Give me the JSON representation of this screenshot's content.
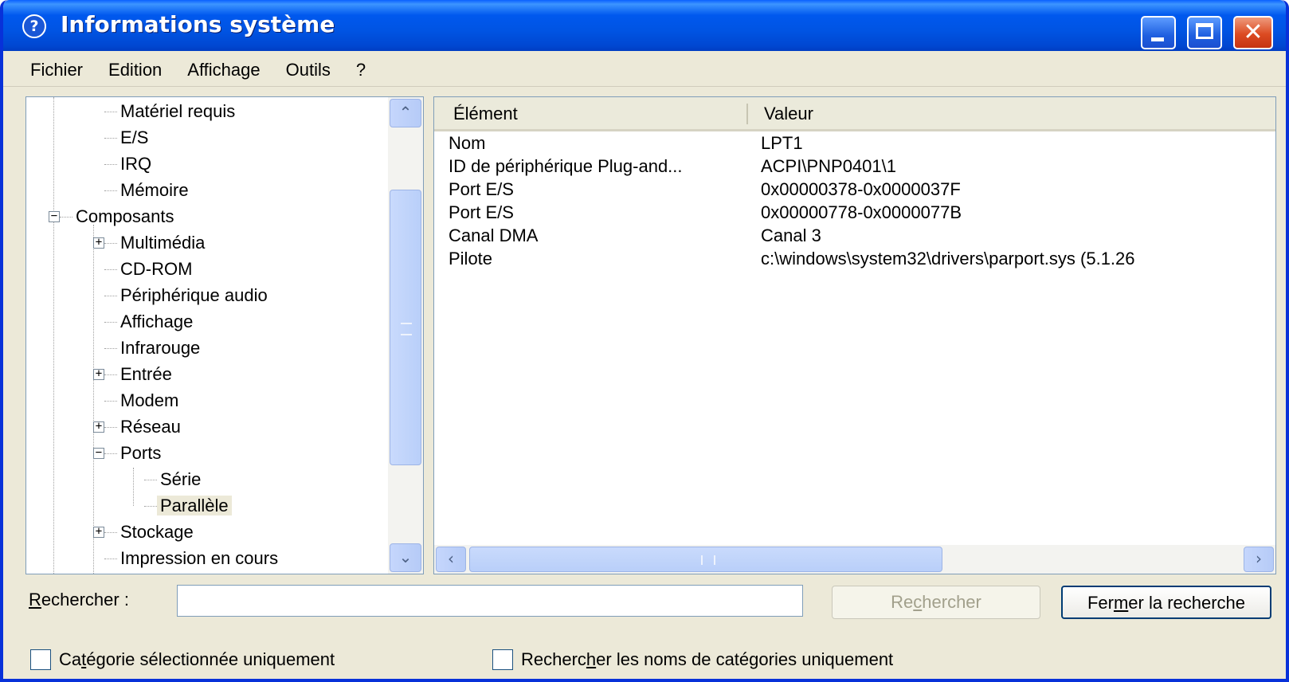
{
  "window": {
    "title": "Informations système",
    "title_icon": "help-circle-icon",
    "controls": [
      "minimize",
      "maximize",
      "close"
    ]
  },
  "menu": [
    "Fichier",
    "Edition",
    "Affichage",
    "Outils",
    "?"
  ],
  "tree": [
    {
      "label": "Matériel requis",
      "level": 2,
      "expander": null
    },
    {
      "label": "E/S",
      "level": 2,
      "expander": null
    },
    {
      "label": "IRQ",
      "level": 2,
      "expander": null
    },
    {
      "label": "Mémoire",
      "level": 2,
      "expander": null
    },
    {
      "label": "Composants",
      "level": 1,
      "expander": "minus"
    },
    {
      "label": "Multimédia",
      "level": 2,
      "expander": "plus"
    },
    {
      "label": "CD-ROM",
      "level": 2,
      "expander": null
    },
    {
      "label": "Périphérique audio",
      "level": 2,
      "expander": null
    },
    {
      "label": "Affichage",
      "level": 2,
      "expander": null
    },
    {
      "label": "Infrarouge",
      "level": 2,
      "expander": null
    },
    {
      "label": "Entrée",
      "level": 2,
      "expander": "plus"
    },
    {
      "label": "Modem",
      "level": 2,
      "expander": null
    },
    {
      "label": "Réseau",
      "level": 2,
      "expander": "plus"
    },
    {
      "label": "Ports",
      "level": 2,
      "expander": "minus"
    },
    {
      "label": "Série",
      "level": 3,
      "expander": null
    },
    {
      "label": "Parallèle",
      "level": 3,
      "expander": null,
      "selected": true
    },
    {
      "label": "Stockage",
      "level": 2,
      "expander": "plus"
    },
    {
      "label": "Impression en cours",
      "level": 2,
      "expander": null
    }
  ],
  "list": {
    "columns": [
      "Élément",
      "Valeur"
    ],
    "rows": [
      [
        "Nom",
        "LPT1"
      ],
      [
        "ID de périphérique Plug-and...",
        "ACPI\\PNP0401\\1"
      ],
      [
        "Port E/S",
        "0x00000378-0x0000037F"
      ],
      [
        "Port E/S",
        "0x00000778-0x0000077B"
      ],
      [
        "Canal DMA",
        "Canal 3"
      ],
      [
        "Pilote",
        "c:\\windows\\system32\\drivers\\parport.sys (5.1.26"
      ]
    ]
  },
  "search": {
    "label_first": "R",
    "label_rest": "echercher :",
    "value": "",
    "button_search_a": "Re",
    "button_search_u": "c",
    "button_search_b": "hercher",
    "button_close_a": "Fer",
    "button_close_u": "m",
    "button_close_b": "er la recherche"
  },
  "checkboxes": [
    {
      "a": "Ca",
      "u": "t",
      "b": "égorie sélectionnée uniquement",
      "checked": false
    },
    {
      "a": "Recherc",
      "u": "h",
      "b": "er les noms de catégories uniquement",
      "checked": false
    }
  ],
  "colors": {
    "titlebar": "#0054e3",
    "selection": "#ece9d8",
    "face": "#ece9d8"
  }
}
